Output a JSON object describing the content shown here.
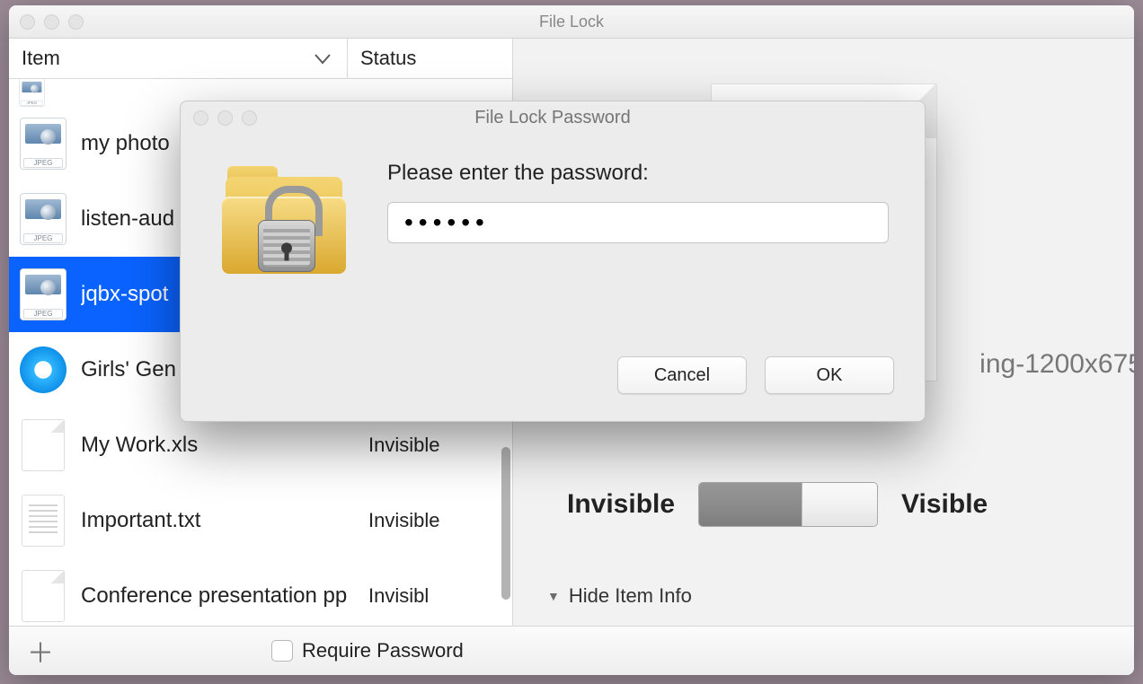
{
  "window": {
    "title": "File Lock"
  },
  "columns": {
    "item": "Item",
    "status": "Status"
  },
  "items": [
    {
      "name": "",
      "status": "",
      "icon": "jpeg",
      "selected": false,
      "truncated": true
    },
    {
      "name": "my photo",
      "status": "",
      "icon": "jpeg",
      "selected": false,
      "truncated": true
    },
    {
      "name": "listen-aud",
      "status": "",
      "icon": "jpeg",
      "selected": false,
      "truncated": true
    },
    {
      "name": "jqbx-spot",
      "status": "",
      "icon": "jpeg",
      "selected": true,
      "truncated": true
    },
    {
      "name": "Girls' Gen",
      "status": "",
      "icon": "disc",
      "selected": false,
      "truncated": true
    },
    {
      "name": "My Work.xls",
      "status": "Invisible",
      "icon": "sheet",
      "selected": false,
      "truncated": false
    },
    {
      "name": "Important.txt",
      "status": "Invisible",
      "icon": "txt",
      "selected": false,
      "truncated": false
    },
    {
      "name": "Conference presentation pp",
      "status": "Invisibl",
      "icon": "sheet",
      "selected": false,
      "truncated": true
    }
  ],
  "bottom": {
    "require_password_label": "Require Password",
    "require_password_checked": false
  },
  "detail": {
    "filename_fragment": "ing-1200x675",
    "invisible_label": "Invisible",
    "visible_label": "Visible",
    "toggle_state": "visible",
    "hide_info_label": "Hide Item Info"
  },
  "modal": {
    "title": "File Lock Password",
    "prompt": "Please enter the password:",
    "password_value": "••••••",
    "cancel_label": "Cancel",
    "ok_label": "OK"
  },
  "icons": {
    "jpeg_badge": "JPEG"
  }
}
